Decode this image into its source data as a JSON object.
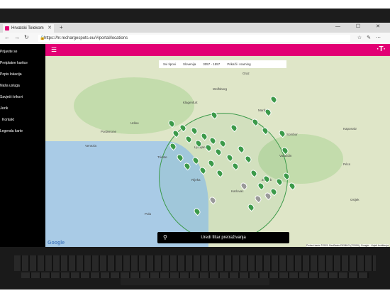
{
  "browser": {
    "tab_title": "Hrvatski Telekom",
    "url": "https://hr.rechargespots.eu/#/portal/locations",
    "new_tab": "+",
    "window_controls": "— ☐ ✕"
  },
  "app": {
    "brand_color": "#e20074",
    "sidebar_items": [
      {
        "label": "Prijavite se"
      },
      {
        "label": "Pretplatne kartice"
      },
      {
        "label": "Popis lokacija"
      },
      {
        "label": "Naša usluga"
      },
      {
        "label": "Savjeti i trikovi"
      },
      {
        "label": "Jezik"
      },
      {
        "label": "Kontakt"
      },
      {
        "label": "Legenda karte"
      }
    ],
    "filters": [
      "Svi tipovi",
      "Slovenija",
      "3057 - 1557",
      "Prikaži i roaming"
    ],
    "bottom_button": "Uredi filtar pretraživanja",
    "map_attribution": "Podaci karte ©2021 GeoBasis-DE/BKG (©2009), Google · Uvjeti korištenja"
  },
  "map": {
    "cities": [
      {
        "name": "Graz"
      },
      {
        "name": "Klagenfurt"
      },
      {
        "name": "Wolfsberg"
      },
      {
        "name": "Maribor"
      },
      {
        "name": "Ljubljana"
      },
      {
        "name": "Zagreb"
      },
      {
        "name": "Udine"
      },
      {
        "name": "Venezia"
      },
      {
        "name": "Trieste"
      },
      {
        "name": "Rijeka"
      },
      {
        "name": "Pula"
      },
      {
        "name": "Karlovac"
      },
      {
        "name": "Varaždin"
      },
      {
        "name": "Sombor"
      },
      {
        "name": "Pordenone"
      },
      {
        "name": "Kaposvár"
      },
      {
        "name": "Pécs"
      },
      {
        "name": "Osijek"
      }
    ],
    "google_label": "Google"
  }
}
